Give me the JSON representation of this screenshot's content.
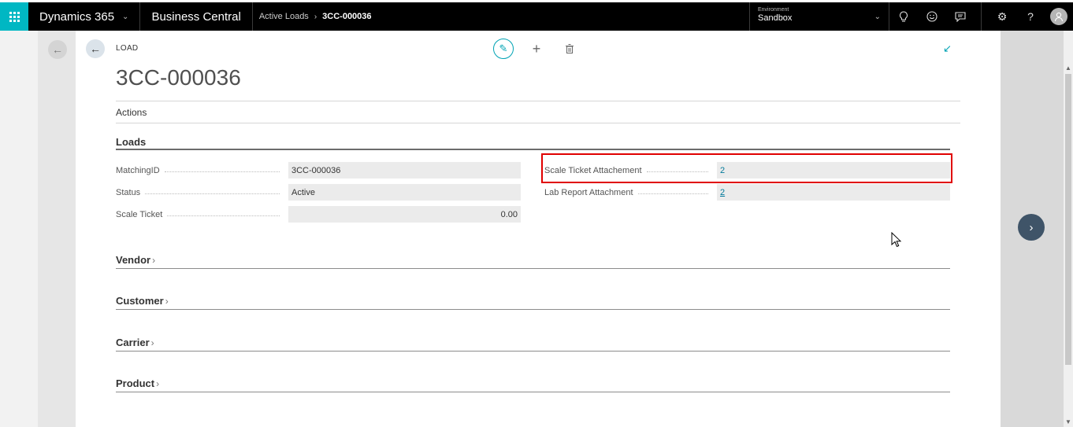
{
  "topbar": {
    "brand": "Dynamics 365",
    "product": "Business Central",
    "breadcrumb": [
      "Active Loads",
      "3CC-000036"
    ],
    "environment_label": "Environment",
    "environment_value": "Sandbox"
  },
  "page": {
    "caption": "LOAD",
    "title": "3CC-000036",
    "actions_label": "Actions"
  },
  "loads_section": {
    "title": "Loads",
    "fields_left": [
      {
        "label": "MatchingID",
        "value": "3CC-000036"
      },
      {
        "label": "Status",
        "value": "Active"
      },
      {
        "label": "Scale Ticket",
        "value": "0.00"
      }
    ],
    "fields_right": [
      {
        "label": "Scale Ticket Attachement",
        "value": "2"
      },
      {
        "label": "Lab Report Attachment",
        "value": "2"
      }
    ]
  },
  "collapsed_sections": [
    {
      "title": "Vendor"
    },
    {
      "title": "Customer"
    },
    {
      "title": "Carrier"
    },
    {
      "title": "Product"
    }
  ],
  "colors": {
    "accent": "#00a3b4",
    "highlight": "#e00000",
    "topbar": "#000000"
  }
}
